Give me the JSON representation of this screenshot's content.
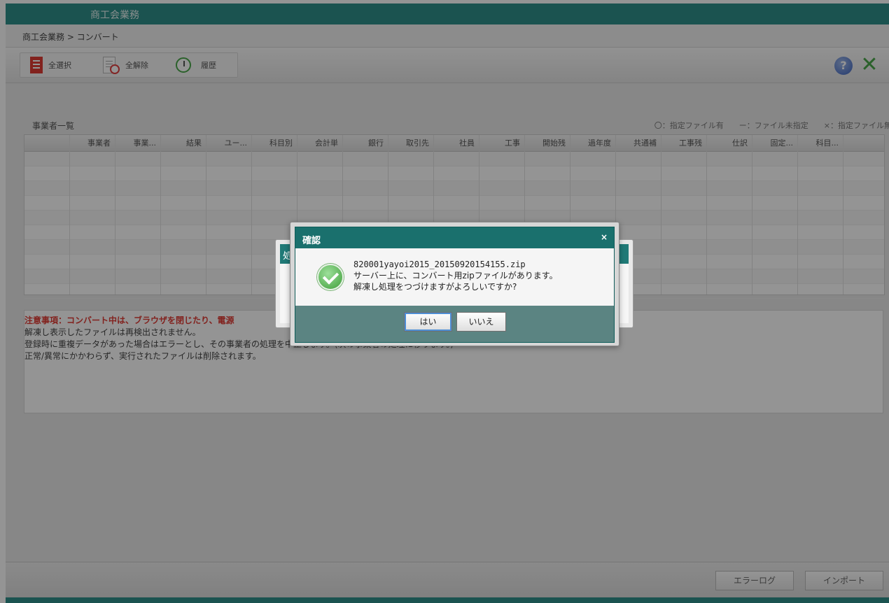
{
  "window": {
    "title": "商工会業務"
  },
  "breadcrumb": "商工会業務 > コンバート",
  "toolbar": {
    "select_all": "全選択",
    "clear_all": "全解除",
    "history": "履歴"
  },
  "section": {
    "title": "事業者一覧",
    "legend": [
      "〇：指定ファイル有",
      "ー：ファイル未指定",
      "×：指定ファイル無"
    ]
  },
  "grid": {
    "columns": [
      "",
      "事業者",
      "事業...",
      "結果",
      "ユー...",
      "科目別",
      "会計単",
      "銀行",
      "取引先",
      "社員",
      "工事",
      "開始残",
      "過年度",
      "共通補",
      "工事残",
      "仕訳",
      "固定...",
      "科目..."
    ]
  },
  "notes": {
    "warning": "注意事項：コンバート中は、ブラウザを閉じたり、電源",
    "lines": [
      "解凍し表示したファイルは再検出されません。",
      "登録時に重複データがあった場合はエラーとし、その事業者の処理を中止します。(次の事業者の処理に移ります。)",
      "正常/異常にかかわらず、実行されたファイルは削除されます。"
    ]
  },
  "footer": {
    "error_log": "エラーログ",
    "import": "インポート"
  },
  "processing_dialog": {
    "title_fragment": "処"
  },
  "confirm_dialog": {
    "title": "確認",
    "close": "×",
    "filename": "820001yayoi2015_20150920154155.zip",
    "line1": "サーバー上に、コンバート用zipファイルがあります。",
    "line2": "解凍し処理をつづけますがよろしいですか?",
    "yes": "はい",
    "no": "いいえ"
  }
}
